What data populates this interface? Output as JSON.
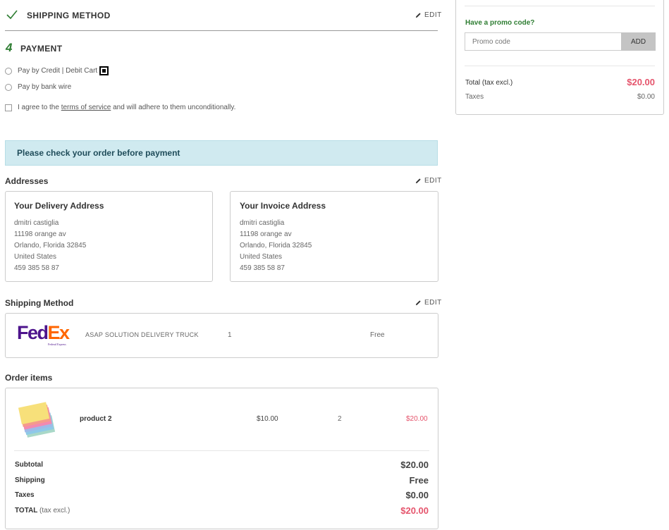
{
  "shipping_step": {
    "title": "SHIPPING METHOD",
    "edit": "EDIT"
  },
  "payment_step": {
    "number": "4",
    "title": "PAYMENT",
    "options": [
      "Pay by Credit | Debit Cart",
      "Pay by bank wire"
    ],
    "terms_prefix": "I agree to the",
    "terms_link": "terms of service",
    "terms_suffix": "and will adhere to them unconditionally."
  },
  "review_notice": "Please check your order before payment",
  "addresses": {
    "heading": "Addresses",
    "edit": "EDIT",
    "delivery": {
      "title": "Your Delivery Address",
      "lines": [
        "dmitri castiglia",
        "11198 orange av",
        "Orlando, Florida 32845",
        "United States",
        "459 385 58 87"
      ]
    },
    "invoice": {
      "title": "Your Invoice Address",
      "lines": [
        "dmitri castiglia",
        "11198 orange av",
        "Orlando, Florida 32845",
        "United States",
        "459 385 58 87"
      ]
    }
  },
  "shipping_method": {
    "heading": "Shipping Method",
    "edit": "EDIT",
    "carrier_logo": {
      "fed": "Fed",
      "ex": "Ex",
      "sub": "Federal Express"
    },
    "carrier_name": "ASAP SOLUTION DELIVERY TRUCK",
    "delay": "1",
    "price": "Free"
  },
  "order_items": {
    "heading": "Order items",
    "items": [
      {
        "name": "product 2",
        "unit_price": "$10.00",
        "quantity": "2",
        "total": "$20.00"
      }
    ],
    "totals": {
      "subtotal_label": "Subtotal",
      "subtotal": "$20.00",
      "shipping_label": "Shipping",
      "shipping": "Free",
      "taxes_label": "Taxes",
      "taxes": "$0.00",
      "total_label": "TOTAL",
      "total_note": "(tax excl.)",
      "total": "$20.00"
    }
  },
  "cart_summary": {
    "promo_label": "Have a promo code?",
    "promo_placeholder": "Promo code",
    "promo_button": "ADD",
    "total_label": "Total (tax excl.)",
    "total": "$20.00",
    "taxes_label": "Taxes",
    "taxes": "$0.00"
  },
  "colors": {
    "accent_green": "#2e7d32",
    "price_pink": "#e5546c",
    "notice_bg": "#d0eaf0"
  }
}
